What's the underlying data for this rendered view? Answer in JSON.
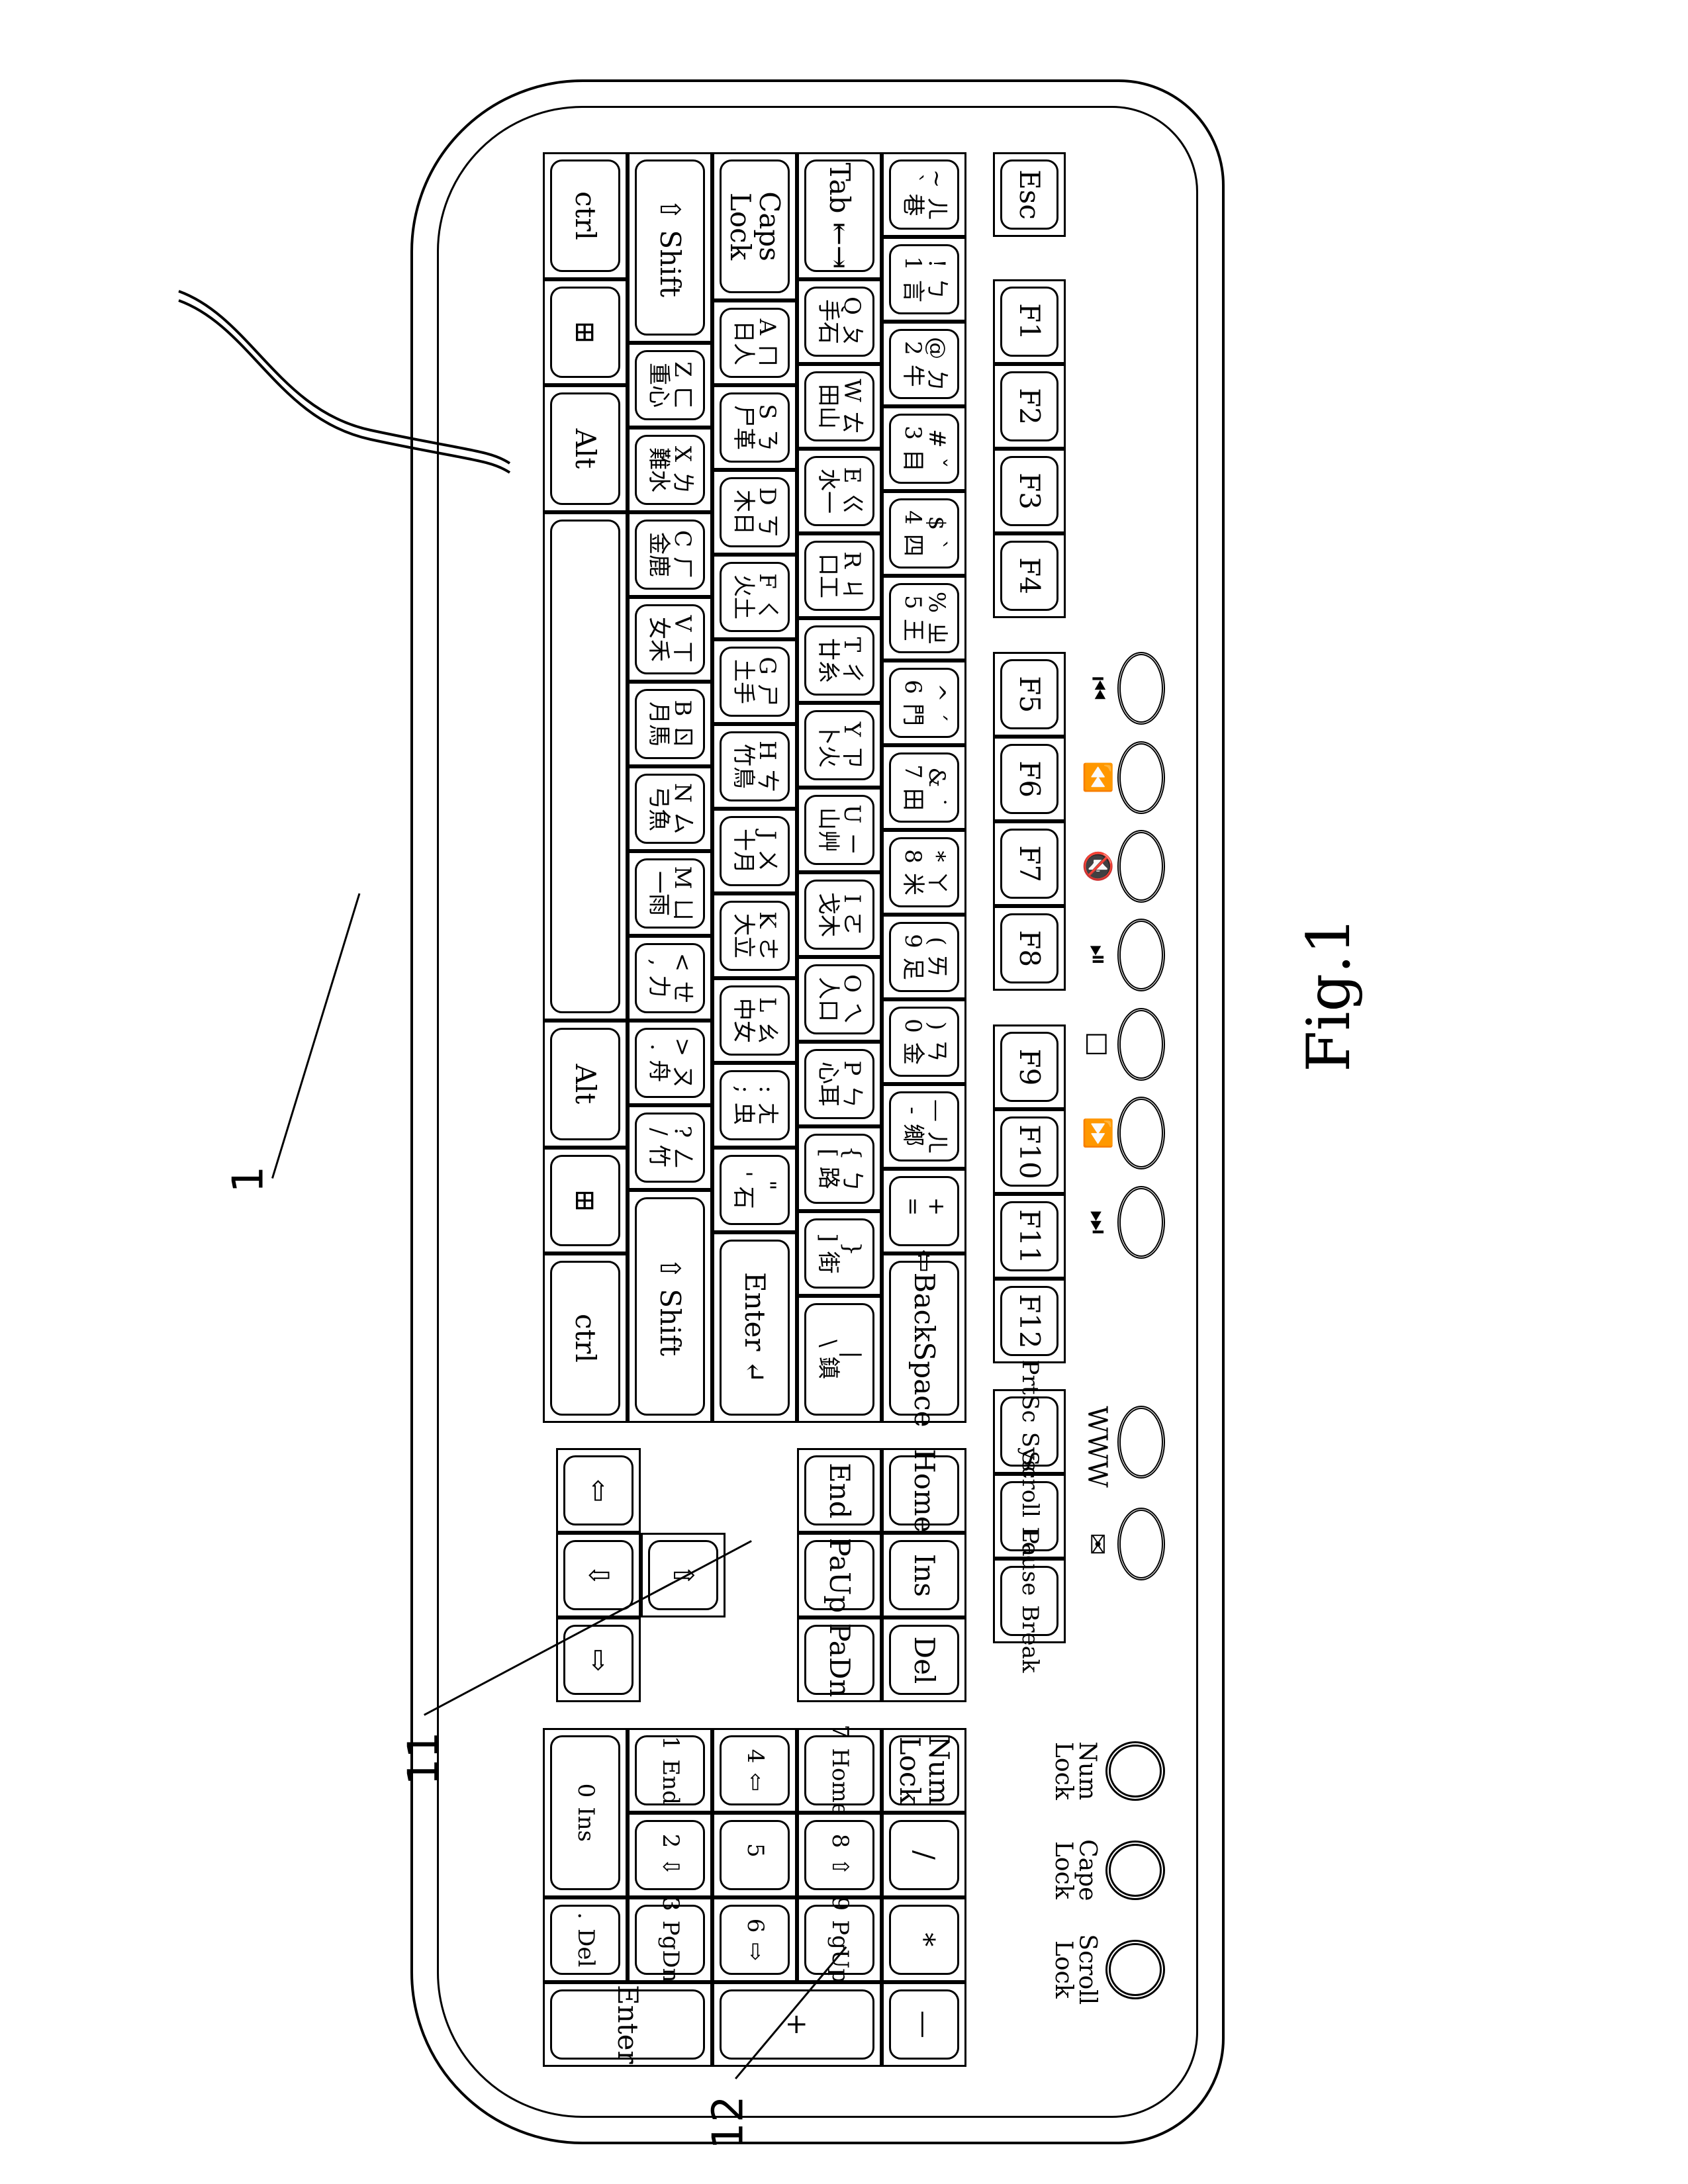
{
  "figure": {
    "caption": "Fig.1"
  },
  "callouts": {
    "keyboard": "1",
    "key_region_11": "11",
    "key_region_12": "12"
  },
  "indicators": [
    {
      "label": "Num Lock"
    },
    {
      "label": "Cape Lock"
    },
    {
      "label": "Scroll Lock"
    }
  ],
  "quick_buttons": [
    {
      "icon": "www",
      "label": "WWW"
    },
    {
      "icon": "mail-icon",
      "label": "✉"
    }
  ],
  "media_buttons": [
    {
      "icon": "previous-track-icon",
      "glyph": "⏮"
    },
    {
      "icon": "rewind-icon",
      "glyph": "⏪"
    },
    {
      "icon": "mute-icon",
      "glyph": "🔇"
    },
    {
      "icon": "play-pause-icon",
      "glyph": "⏯"
    },
    {
      "icon": "stop-icon",
      "glyph": "□"
    },
    {
      "icon": "fast-forward-icon",
      "glyph": "⏩"
    },
    {
      "icon": "next-track-icon",
      "glyph": "⏭"
    }
  ],
  "function_row": [
    "Esc",
    "F1",
    "F2",
    "F3",
    "F4",
    "F5",
    "F6",
    "F7",
    "F8",
    "F9",
    "F10",
    "F11",
    "F12"
  ],
  "system_keys": [
    {
      "top": "PrtSc",
      "bottom": "SysRq"
    },
    {
      "top": "Scroll",
      "bottom": "Lock"
    },
    {
      "top": "Pause",
      "bottom": "Break"
    }
  ],
  "number_row": [
    {
      "top": "~",
      "zh": "ㄦ",
      "sub": "`",
      "cj": "巷"
    },
    {
      "top": "!",
      "zh": "ㄅ",
      "sub": "1",
      "cj": "言"
    },
    {
      "top": "@",
      "zh": "ㄉ",
      "sub": "2",
      "cj": "牛"
    },
    {
      "top": "#",
      "zh": "ˇ",
      "sub": "3",
      "cj": "目"
    },
    {
      "top": "$",
      "zh": "ˋ",
      "sub": "4",
      "cj": "四"
    },
    {
      "top": "%",
      "zh": "ㄓ",
      "sub": "5",
      "cj": "王"
    },
    {
      "top": "^",
      "zh": "ˊ",
      "sub": "6",
      "cj": "門"
    },
    {
      "top": "&",
      "zh": "˙",
      "sub": "7",
      "cj": "田"
    },
    {
      "top": "*",
      "zh": "ㄚ",
      "sub": "8",
      "cj": "米"
    },
    {
      "top": "(",
      "zh": "ㄞ",
      "sub": "9",
      "cj": "足"
    },
    {
      "top": ")",
      "zh": "ㄢ",
      "sub": "0",
      "cj": "金"
    },
    {
      "top": "—",
      "zh": "ㄦ",
      "sub": "-",
      "cj": "鄉"
    },
    {
      "top": "+",
      "zh": "",
      "sub": "=",
      "cj": ""
    },
    {
      "label": "⇦BackSpace"
    }
  ],
  "qwerty_row": [
    {
      "label": "Tab ⇤⇥"
    },
    {
      "top": "Q",
      "zh": "ㄆ",
      "cj": "手石"
    },
    {
      "top": "W",
      "zh": "ㄊ",
      "cj": "田山"
    },
    {
      "top": "E",
      "zh": "ㄍ",
      "cj": "水一"
    },
    {
      "top": "R",
      "zh": "ㄐ",
      "cj": "口工"
    },
    {
      "top": "T",
      "zh": "ㄔ",
      "cj": "廿糸"
    },
    {
      "top": "Y",
      "zh": "ㄗ",
      "cj": "卜火"
    },
    {
      "top": "U",
      "zh": "ㄧ",
      "cj": "山艸"
    },
    {
      "top": "I",
      "zh": "ㄛ",
      "cj": "戈木"
    },
    {
      "top": "O",
      "zh": "ㄟ",
      "cj": "人口"
    },
    {
      "top": "P",
      "zh": "ㄣ",
      "cj": "心耳"
    },
    {
      "top": "{",
      "zh": "ㄅ",
      "sub": "[",
      "cj": "路"
    },
    {
      "top": "}",
      "zh": "",
      "sub": "]",
      "cj": "街"
    },
    {
      "top": "|",
      "zh": "",
      "sub": "\\",
      "cj": "鎮"
    }
  ],
  "home_row": [
    {
      "label": "Caps Lock"
    },
    {
      "top": "A",
      "zh": "ㄇ",
      "cj": "日人"
    },
    {
      "top": "S",
      "zh": "ㄋ",
      "cj": "尸革"
    },
    {
      "top": "D",
      "zh": "ㄎ",
      "cj": "木日"
    },
    {
      "top": "F",
      "zh": "ㄑ",
      "cj": "火土"
    },
    {
      "top": "G",
      "zh": "ㄕ",
      "cj": "土手"
    },
    {
      "top": "H",
      "zh": "ㄘ",
      "cj": "竹鳥"
    },
    {
      "top": "J",
      "zh": "ㄨ",
      "cj": "十月"
    },
    {
      "top": "K",
      "zh": "ㄜ",
      "cj": "大立"
    },
    {
      "top": "L",
      "zh": "ㄠ",
      "cj": "中女"
    },
    {
      "top": ":",
      "zh": "ㄤ",
      "sub": ";",
      "cj": "虫"
    },
    {
      "top": "\"",
      "zh": "",
      "sub": "'",
      "cj": "石"
    },
    {
      "label": "Enter ↵"
    }
  ],
  "shift_row": [
    {
      "label": "⇧ Shift"
    },
    {
      "top": "Z",
      "zh": "ㄈ",
      "cj": "重心"
    },
    {
      "top": "X",
      "zh": "ㄌ",
      "cj": "難水"
    },
    {
      "top": "C",
      "zh": "ㄏ",
      "cj": "金鹿"
    },
    {
      "top": "V",
      "zh": "ㄒ",
      "cj": "女禾"
    },
    {
      "top": "B",
      "zh": "ㄖ",
      "cj": "月馬"
    },
    {
      "top": "N",
      "zh": "ㄙ",
      "cj": "弓魚"
    },
    {
      "top": "M",
      "zh": "ㄩ",
      "cj": "一雨"
    },
    {
      "top": "<",
      "zh": "ㄝ",
      "sub": ",",
      "cj": "力"
    },
    {
      "top": ">",
      "zh": "ㄡ",
      "sub": ".",
      "cj": "舟"
    },
    {
      "top": "?",
      "zh": "ㄥ",
      "sub": "/",
      "cj": "竹"
    },
    {
      "label": "⇧ Shift"
    }
  ],
  "bottom_row": [
    {
      "label": "ctrl"
    },
    {
      "label": "⊞"
    },
    {
      "label": "Alt"
    },
    {
      "label": ""
    },
    {
      "label": "Alt"
    },
    {
      "label": "⊞"
    },
    {
      "label": "ctrl"
    }
  ],
  "nav_cluster": [
    {
      "label": "Home"
    },
    {
      "label": "End"
    },
    {
      "label": "Ins"
    },
    {
      "label": "PaUp"
    },
    {
      "label": "Del"
    },
    {
      "label": "PaDn"
    }
  ],
  "arrows": [
    {
      "label": "⇧",
      "name": "arrow-up"
    },
    {
      "label": "⇦",
      "name": "arrow-left"
    },
    {
      "label": "⇩",
      "name": "arrow-down"
    },
    {
      "label": "⇨",
      "name": "arrow-right"
    }
  ],
  "numpad": [
    {
      "label": "Num Lock"
    },
    {
      "label": "/"
    },
    {
      "label": "*"
    },
    {
      "label": "—"
    },
    {
      "top": "7",
      "bottom": "Home"
    },
    {
      "top": "8",
      "bottom": "⇧"
    },
    {
      "top": "9",
      "bottom": "PgUp"
    },
    {
      "label": "+"
    },
    {
      "top": "4",
      "bottom": "⇦"
    },
    {
      "top": "5",
      "bottom": ""
    },
    {
      "top": "6",
      "bottom": "⇨"
    },
    {
      "top": "1",
      "bottom": "End"
    },
    {
      "top": "2",
      "bottom": "⇩"
    },
    {
      "top": "3",
      "bottom": "PgDn"
    },
    {
      "label": "Enter"
    },
    {
      "top": "0",
      "bottom": "Ins"
    },
    {
      "top": ".",
      "bottom": "Del"
    }
  ]
}
